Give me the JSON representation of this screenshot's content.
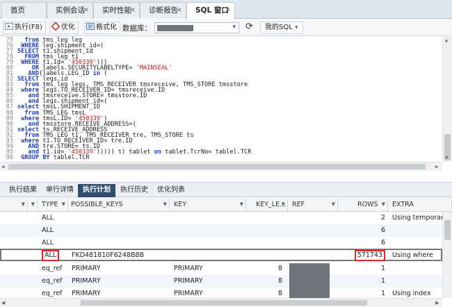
{
  "tabs": [
    {
      "label": "首页"
    },
    {
      "label": "实例会话"
    },
    {
      "label": "实时性能"
    },
    {
      "label": "诊断报告"
    },
    {
      "label": "SQL 窗口"
    }
  ],
  "tab_close_glyph": "×",
  "toolbar": {
    "execute_label": "执行(F8)",
    "optimize_label": "优化",
    "format_label": "格式化",
    "db_label": "数据库：",
    "mysql_label": "我的SQL",
    "refresh_glyph": "⟳",
    "dropdown_glyph": "▾"
  },
  "editor_lines": [
    {
      "n": "75",
      "text": "  from tms_leg leg"
    },
    {
      "n": "76",
      "text": " WHERE leg.shipment_id=("
    },
    {
      "n": "77",
      "text": "SELECT t1.shipment_id"
    },
    {
      "n": "78",
      "text": "  FROM tms_leg t1"
    },
    {
      "n": "79",
      "text": " WHERE t1.id= '450339')))"
    },
    {
      "n": "80",
      "text": "    OR labels.SECURITYLABELTYPE= 'MAINSEAL'"
    },
    {
      "n": "81",
      "text": "   AND(labels.LEG_ID in ("
    },
    {
      "n": "82",
      "text": "SELECT legs.id"
    },
    {
      "n": "83",
      "text": "  from tms_leg legs, TMS_RECEIVER tmsreceive, TMS_STORE tmsstore"
    },
    {
      "n": "84",
      "text": " where legs.TO_RECEIVER_ID= tmsreceive.ID"
    },
    {
      "n": "85",
      "text": "   and tmsreceive.STORE= tmsstore.ID"
    },
    {
      "n": "86",
      "text": "   and legs.shipment_id=("
    },
    {
      "n": "87",
      "text": "select tmsL.SHIPMENT_ID"
    },
    {
      "n": "88",
      "text": "  from TMS_LEG tmsL"
    },
    {
      "n": "89",
      "text": " where tmsL.ID= '450339')"
    },
    {
      "n": "90",
      "text": "   and tmsstore.RECEIVE_ADDRESS=("
    },
    {
      "n": "91",
      "text": "select ts.RECEIVE_ADDRESS"
    },
    {
      "n": "92",
      "text": "  from TMS_LEG t1, TMS_RECEIVER tre, TMS_STORE ts"
    },
    {
      "n": "93",
      "text": " where t1.TO_RECEIVER_ID= tre.ID"
    },
    {
      "n": "94",
      "text": "   AND tre.STORE= ts.ID"
    },
    {
      "n": "95",
      "text": "   and t1.id= '450339'))))) t) tablet on tablet.TcrNo= tablel.TCR"
    },
    {
      "n": "96",
      "text": " GROUP BY tablel.TCR"
    }
  ],
  "result_tabs": [
    {
      "label": "执行结果"
    },
    {
      "label": "单行详情"
    },
    {
      "label": "执行计划",
      "active": true
    },
    {
      "label": "执行历史"
    },
    {
      "label": "优化列表"
    }
  ],
  "grid": {
    "columns": [
      "TYPE",
      "POSSIBLE_KEYS",
      "KEY",
      "KEY_LE...",
      "REF",
      "ROWS",
      "EXTRA"
    ],
    "rows": [
      {
        "type": "ALL",
        "possible_keys": "",
        "key": "",
        "key_len": "",
        "ref": "",
        "rows": "2",
        "extra": "Using temporary"
      },
      {
        "type": "ALL",
        "possible_keys": "",
        "key": "",
        "key_len": "",
        "ref": "",
        "rows": "6",
        "extra": ""
      },
      {
        "type": "ALL",
        "possible_keys": "",
        "key": "",
        "key_len": "",
        "ref": "",
        "rows": "6",
        "extra": ""
      },
      {
        "type": "ALL",
        "possible_keys": "FKD481810F6248B8B",
        "key": "",
        "key_len": "",
        "ref": "",
        "rows": "571743",
        "extra": "Using where",
        "selected": true
      },
      {
        "type": "eq_ref",
        "possible_keys": "PRIMARY",
        "key": "PRIMARY",
        "key_len": "8",
        "ref": "",
        "rows": "1",
        "extra": ""
      },
      {
        "type": "eq_ref",
        "possible_keys": "PRIMARY",
        "key": "PRIMARY",
        "key_len": "8",
        "ref": "",
        "rows": "1",
        "extra": ""
      },
      {
        "type": "eq_ref",
        "possible_keys": "PRIMARY",
        "key": "PRIMARY",
        "key_len": "8",
        "ref": "",
        "rows": "1",
        "extra": "Using index"
      }
    ]
  },
  "colors": {
    "highlight_red": "#e0272b",
    "active_tab_bg": "#2f4f6f",
    "keyword_blue": "#1f3fb5",
    "string_red": "#c41a1a"
  }
}
